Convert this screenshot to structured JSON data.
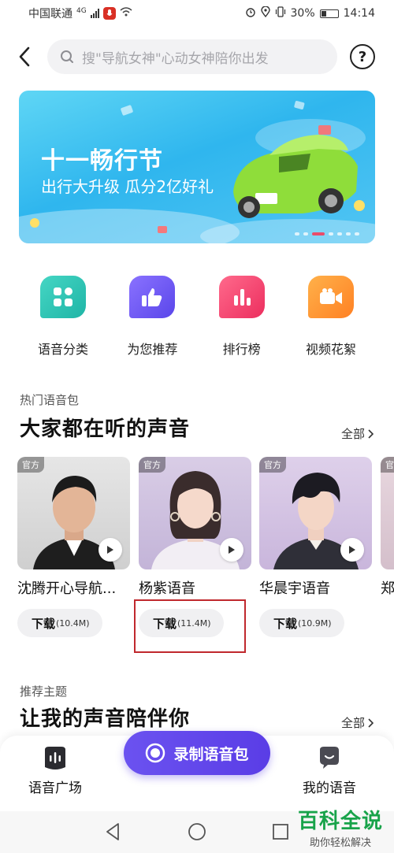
{
  "status_bar": {
    "carrier": "中国联通",
    "network": "4G",
    "battery": "30%",
    "time": "14:14"
  },
  "search": {
    "placeholder": "搜\"导航女神\"心动女神陪你出发"
  },
  "banner": {
    "title": "十一畅行节",
    "subtitle": "出行大升级 瓜分2亿好礼"
  },
  "categories": [
    {
      "label": "语音分类",
      "icon": "grid-icon",
      "color": "#2ec4b6"
    },
    {
      "label": "为您推荐",
      "icon": "thumbs-up-icon",
      "color": "#6a5af9"
    },
    {
      "label": "排行榜",
      "icon": "bar-chart-icon",
      "color": "#f2416d"
    },
    {
      "label": "视频花絮",
      "icon": "video-camera-icon",
      "color": "#ff9326"
    }
  ],
  "hot_section": {
    "subtitle": "热门语音包",
    "title": "大家都在听的声音",
    "see_all": "全部",
    "official_tag": "官方",
    "items": [
      {
        "name": "沈腾开心导航...",
        "download_label": "下载",
        "size": "(10.4M)"
      },
      {
        "name": "杨紫语音",
        "download_label": "下载",
        "size": "(11.4M)"
      },
      {
        "name": "华晨宇语音",
        "download_label": "下载",
        "size": "(10.9M)"
      },
      {
        "name": "郑"
      }
    ]
  },
  "theme_section": {
    "subtitle": "推荐主题",
    "title": "让我的声音陪伴你",
    "see_all": "全部"
  },
  "bottom_nav": {
    "left_label": "语音广场",
    "record_label": "录制语音包",
    "right_label": "我的语音"
  },
  "watermark": {
    "title": "百科全说",
    "subtitle": "助你轻松解决"
  },
  "colors": {
    "accent": "#5a3de6",
    "highlight": "#c0282d"
  }
}
